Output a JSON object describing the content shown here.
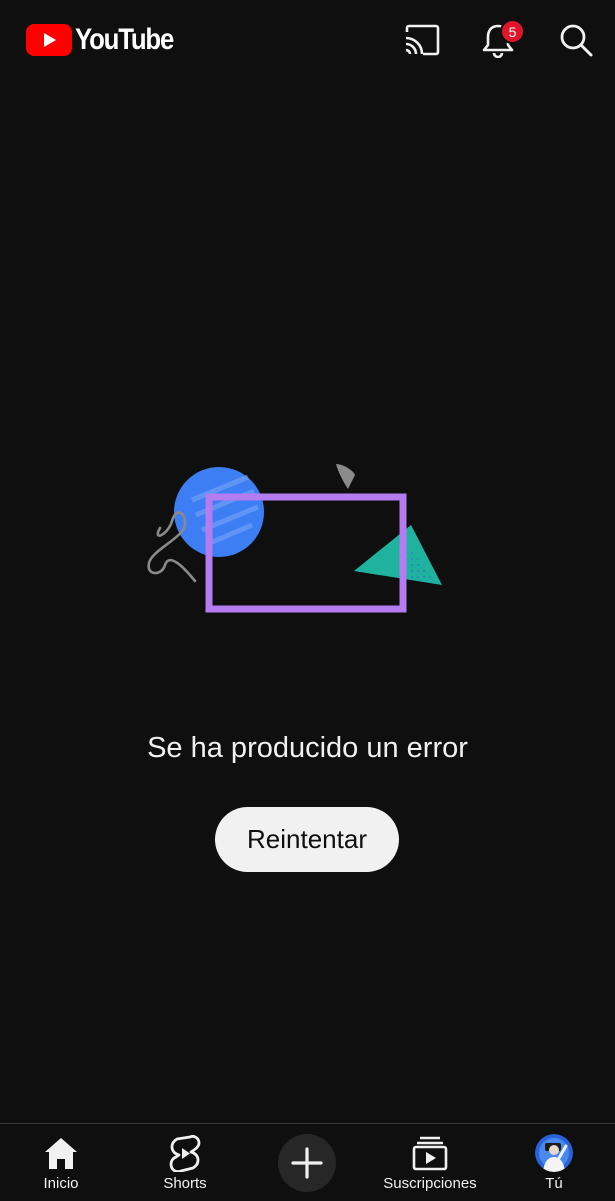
{
  "header": {
    "logo_text": "YouTube",
    "notification_count": "5",
    "icons": [
      "youtube-logo-icon",
      "cast-icon",
      "bell-icon",
      "search-icon"
    ]
  },
  "main": {
    "error_message": "Se ha producido un error",
    "retry_label": "Reintentar"
  },
  "bottom_nav": {
    "items": [
      {
        "label": "Inicio",
        "icon": "home-icon"
      },
      {
        "label": "Shorts",
        "icon": "shorts-icon"
      },
      {
        "label": "",
        "icon": "create-plus-icon"
      },
      {
        "label": "Suscripciones",
        "icon": "subscriptions-icon"
      },
      {
        "label": "Tú",
        "icon": "avatar"
      }
    ]
  },
  "colors": {
    "background": "#0f0f0f",
    "brand_red": "#ff0000",
    "badge_red": "#e0142b",
    "text": "#f1f1f1",
    "illustration_blue": "#3d7ef5",
    "illustration_purple": "#b57cf2",
    "illustration_teal": "#1fb39f"
  }
}
